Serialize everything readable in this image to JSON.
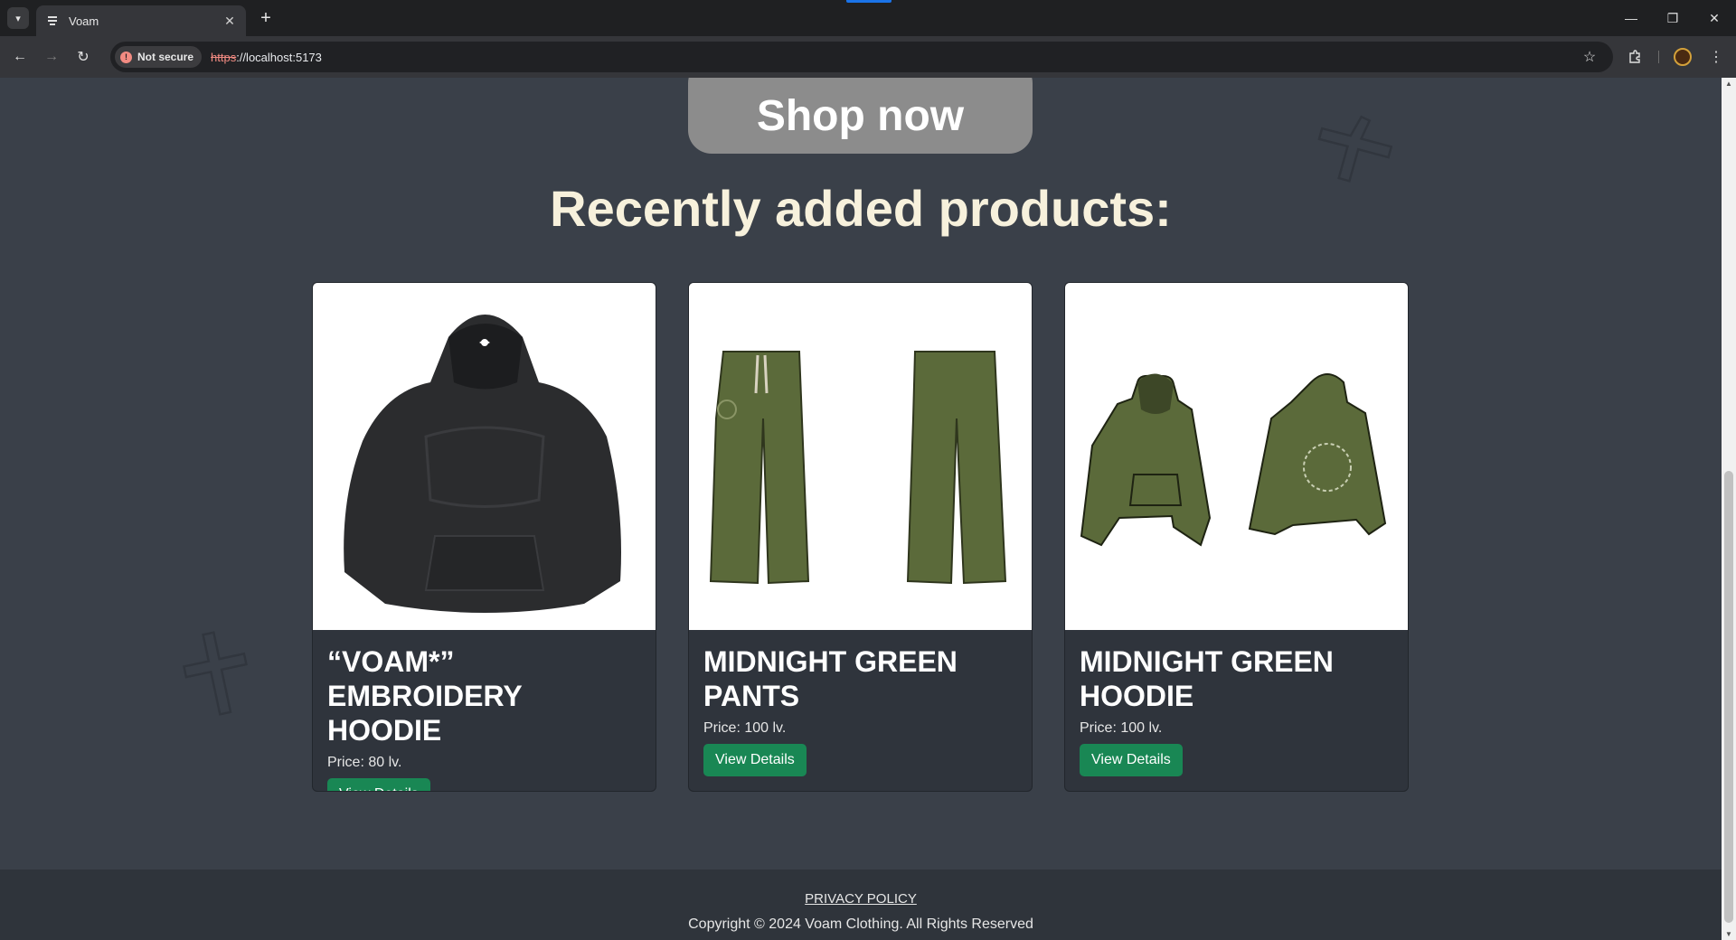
{
  "browser": {
    "tab_title": "Voam",
    "security_label": "Not secure",
    "url_scheme": "https",
    "url_rest": "://localhost:5173"
  },
  "page": {
    "shop_button": "Shop now",
    "section_title": "Recently added products:",
    "products": [
      {
        "name": "“VOAM*” EMBROIDERY HOODIE",
        "price": "Price: 80 lv.",
        "button": "View Details",
        "image": "black-hoodie"
      },
      {
        "name": "MIDNIGHT GREEN PANTS",
        "price": "Price: 100 lv.",
        "button": "View Details",
        "image": "green-pants"
      },
      {
        "name": "MIDNIGHT GREEN HOODIE",
        "price": "Price: 100 lv.",
        "button": "View Details",
        "image": "green-hoodie"
      }
    ]
  },
  "footer": {
    "privacy": "PRIVACY POLICY",
    "copyright": "Copyright © 2024 Voam Clothing. All Rights Reserved"
  },
  "colors": {
    "page_bg": "#3a4049",
    "title_color": "#f7f1dc",
    "button_green": "#198754",
    "product_olive": "#5b6a3a"
  }
}
